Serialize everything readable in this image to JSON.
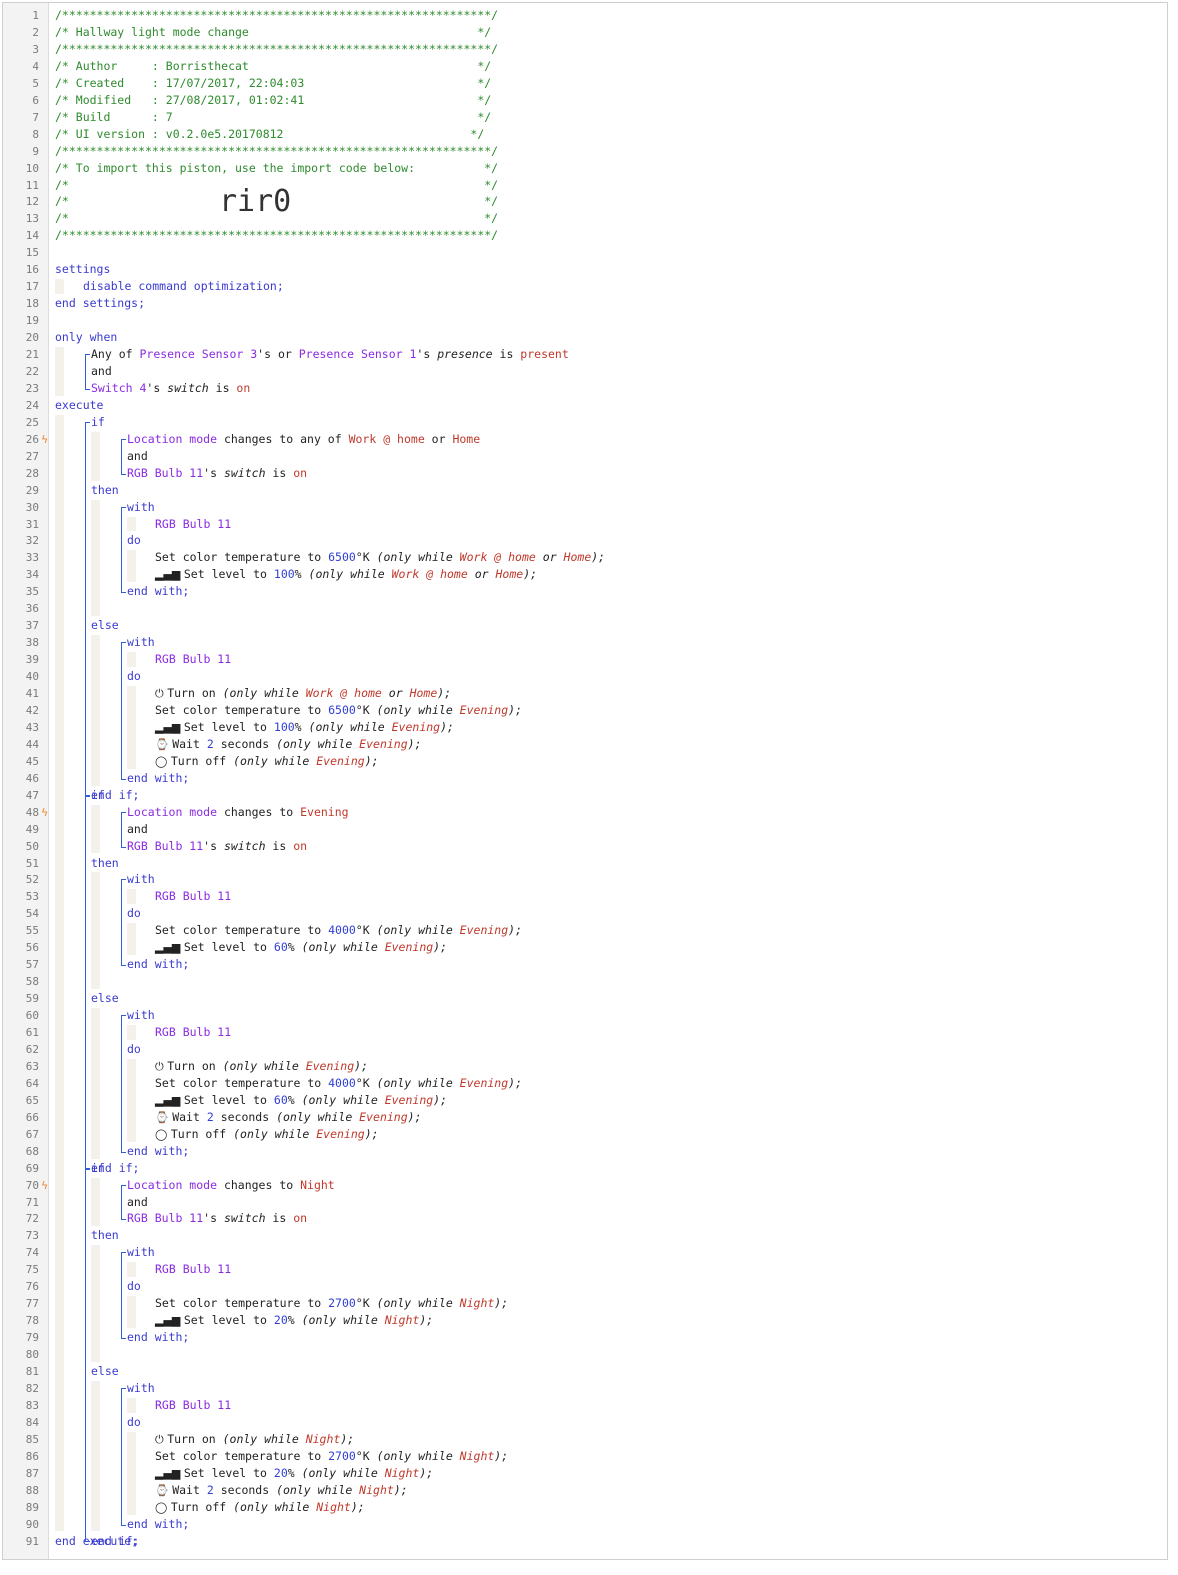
{
  "editor": {
    "header": {
      "border": "/**************************************************************/",
      "title_line": "/* Hallway light mode change                                 */",
      "author_line": "/* Author     : Borristhecat                                 */",
      "created_line": "/* Created    : 17/07/2017, 22:04:03                         */",
      "modified_line": "/* Modified   : 27/08/2017, 01:02:41                         */",
      "build_line": "/* Build      : 7                                            */",
      "uiversion_line": "/* UI version : v0.2.0e5.20170812                           */",
      "import_line": "/* To import this piston, use the import code below:          */",
      "blank_line": "/*                                                            */",
      "import_code_prefix": "/*",
      "import_code": "rir0",
      "import_code_suffix": "*/"
    },
    "labels": {
      "settings": "settings",
      "disable": "disable command optimization;",
      "end_settings": "end settings;",
      "only_when": "only when",
      "execute": "execute",
      "if": "if",
      "then": "then",
      "else": "else",
      "end_if": "end if;",
      "with": "with",
      "do": "do",
      "end_with": "end with;",
      "end_execute": "end execute;",
      "and": "and"
    },
    "devices": {
      "presence3": "Presence Sensor 3",
      "presence1": "Presence Sensor 1",
      "switch4": "Switch 4",
      "rgb": "RGB Bulb 11",
      "location": "Location mode"
    },
    "modes": {
      "work": "Work @ home",
      "home": "Home",
      "evening": "Evening",
      "night": "Night"
    },
    "values": {
      "present": "present",
      "on": "on",
      "temp_6500": "6500",
      "temp_4000": "4000",
      "temp_2700": "2700",
      "level_100": "100",
      "level_60": "60",
      "level_20": "20",
      "wait_2": "2"
    },
    "line_numbers_count": 91,
    "trigger_lines": [
      26,
      48,
      70
    ]
  }
}
